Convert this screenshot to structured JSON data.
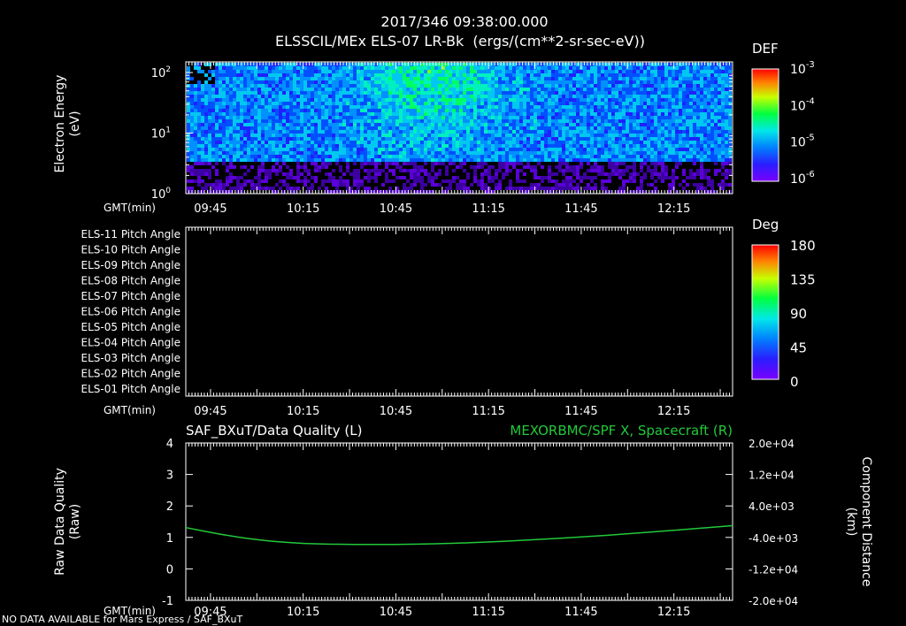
{
  "header": {
    "timestamp": "2017/346 09:38:00.000",
    "title": "ELSSCIL/MEx ELS-07 LR-Bk  (ergs/(cm**2-sr-sec-eV))"
  },
  "footer": {
    "note": "NO DATA AVAILABLE for Mars Express / SAF_BXuT"
  },
  "colors": {
    "background": "#000000",
    "text": "#ffffff",
    "spacecraft_x_line": "#22c93a"
  },
  "time_axis": {
    "label": "GMT(min)",
    "ticks": [
      "09:45",
      "10:15",
      "10:45",
      "11:15",
      "11:45",
      "12:15"
    ],
    "tick_minutes": [
      45,
      75,
      105,
      135,
      165,
      195
    ],
    "range_minutes": [
      37,
      214
    ]
  },
  "chart_data": [
    {
      "type": "heatmap",
      "name": "electron-spectrogram",
      "ylabel": "Electron Energy\n(eV)",
      "y_scale": "log",
      "ylim": [
        1,
        150
      ],
      "y_ticks": [
        {
          "value": 1,
          "base": "10",
          "exp": "0"
        },
        {
          "value": 10,
          "base": "10",
          "exp": "1"
        },
        {
          "value": 100,
          "base": "10",
          "exp": "2"
        }
      ],
      "colorbar": {
        "label": "DEF",
        "scale": "log",
        "ticks": [
          {
            "value": 0.001,
            "base": "10",
            "exp": "-3"
          },
          {
            "value": 0.0001,
            "base": "10",
            "exp": "-4"
          },
          {
            "value": 1e-05,
            "base": "10",
            "exp": "-5"
          },
          {
            "value": 1e-06,
            "base": "10",
            "exp": "-6"
          }
        ]
      }
    },
    {
      "type": "heatmap",
      "name": "pitch-angle-panel",
      "rows": [
        "ELS-11 Pitch Angle",
        "ELS-10 Pitch Angle",
        "ELS-09 Pitch Angle",
        "ELS-08 Pitch Angle",
        "ELS-07 Pitch Angle",
        "ELS-06 Pitch Angle",
        "ELS-05 Pitch Angle",
        "ELS-04 Pitch Angle",
        "ELS-03 Pitch Angle",
        "ELS-02 Pitch Angle",
        "ELS-01 Pitch Angle"
      ],
      "data": "empty",
      "colorbar": {
        "label": "Deg",
        "ticks": [
          "180",
          "135",
          "90",
          "45",
          "0"
        ],
        "range": [
          0,
          180
        ]
      }
    },
    {
      "type": "line",
      "left_title": "SAF_BXuT/Data Quality (L)",
      "right_title": "MEXORBMC/SPF X, Spacecraft (R)",
      "ylabel_left": "Raw Data Quality\n(Raw)",
      "ylabel_right": "Component Distance\n(km)",
      "ylim_left": [
        -1,
        4
      ],
      "yticks_left": [
        "4",
        "3",
        "2",
        "1",
        "0",
        "-1"
      ],
      "ylim_right": [
        -20000,
        20000
      ],
      "yticks_right": [
        "2.0e+04",
        "1.2e+04",
        "4.0e+03",
        "-4.0e+03",
        "-1.2e+04",
        "-2.0e+04"
      ],
      "series": [
        {
          "name": "MEXORBMC/SPF X, Spacecraft",
          "axis": "right",
          "x_minutes": [
            37,
            50,
            62,
            75,
            90,
            105,
            120,
            135,
            150,
            165,
            180,
            195,
            214
          ],
          "values": [
            -1500,
            -3500,
            -4800,
            -5600,
            -5800,
            -5800,
            -5600,
            -5200,
            -4600,
            -3900,
            -3100,
            -2200,
            -1000
          ]
        }
      ]
    }
  ]
}
